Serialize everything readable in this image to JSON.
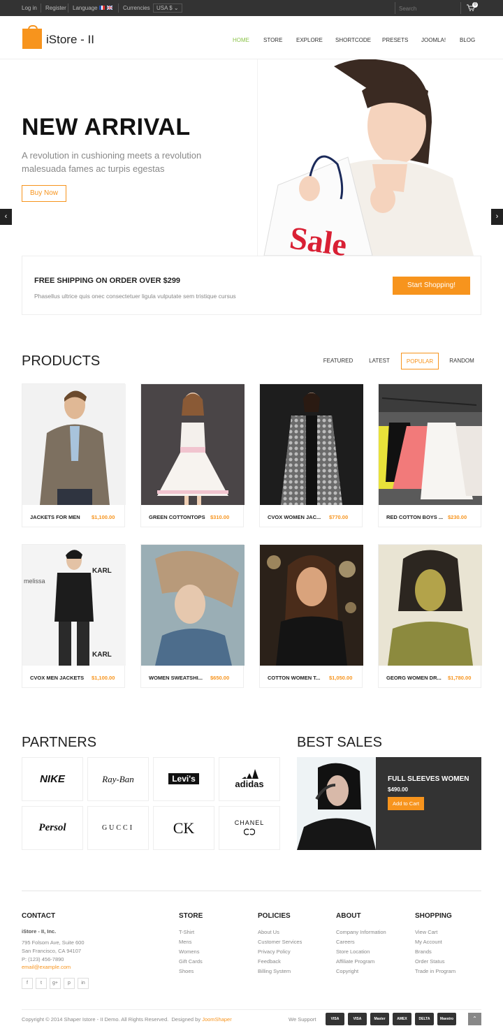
{
  "topbar": {
    "login": "Log in",
    "register": "Register",
    "language": "Language",
    "currencies": "Currencies",
    "currency_value": "USA $ ⌄",
    "search_placeholder": "Search",
    "cart_count": "0"
  },
  "header": {
    "logo": "iStore - II",
    "nav": [
      "HOME",
      "STORE",
      "EXPLORE",
      "SHORTCODE",
      "PRESETS",
      "JOOMLA!",
      "BLOG"
    ]
  },
  "hero": {
    "title": "NEW ARRIVAL",
    "line1": "A revolution in cushioning meets a revolution",
    "line2": "malesuada fames ac turpis egestas",
    "button": "Buy Now",
    "bag_text": "Sale",
    "prev": "‹",
    "next": "›"
  },
  "shipping": {
    "title": "FREE SHIPPING ON ORDER OVER $299",
    "subtitle": "Phasellus ultrice quis onec consectetuer ligula vulputate sem tristique cursus",
    "button": "Start Shopping!"
  },
  "products": {
    "title": "PRODUCTS",
    "tabs": [
      "FEATURED",
      "LATEST",
      "POPULAR",
      "RANDOM"
    ],
    "active_tab": "POPULAR",
    "items": [
      {
        "name": "JACKETS FOR MEN",
        "price": "$1,100.00"
      },
      {
        "name": "GREEN COTTONTOPS",
        "price": "$310.00"
      },
      {
        "name": "CVOX WOMEN JAC...",
        "price": "$770.00"
      },
      {
        "name": "RED COTTON BOYS ...",
        "price": "$230.00"
      },
      {
        "name": "CVOX MEN JACKETS",
        "price": "$1,100.00"
      },
      {
        "name": "WOMEN SWEATSHI...",
        "price": "$650.00"
      },
      {
        "name": "COTTON WOMEN T...",
        "price": "$1,050.00"
      },
      {
        "name": "GEORG WOMEN DR...",
        "price": "$1,780.00"
      }
    ]
  },
  "partners": {
    "title": "PARTNERS",
    "brands": [
      "NIKE",
      "Ray-Ban",
      "Levi's",
      "adidas",
      "Persol",
      "GUCCI",
      "CK",
      "CHANEL"
    ]
  },
  "best_sales": {
    "title": "BEST SALES",
    "name": "FULL SLEEVES WOMEN",
    "price": "$490.00",
    "button": "Add to Cart"
  },
  "footer": {
    "contact": {
      "title": "CONTACT",
      "company": "iStore - II, Inc.",
      "address1": "795 Folsom Ave, Suite 600",
      "address2": "San Francisco, CA 94107",
      "phone": "P: (123) 456-7890",
      "email": "email@example.com"
    },
    "columns": [
      {
        "title": "STORE",
        "links": [
          "T-Shirt",
          "Mens",
          "Womens",
          "Gift Cards",
          "Shoes"
        ]
      },
      {
        "title": "POLICIES",
        "links": [
          "About Us",
          "Customer Services",
          "Privacy Policy",
          "Feedback",
          "Billing System"
        ]
      },
      {
        "title": "ABOUT",
        "links": [
          "Company Information",
          "Careers",
          "Store Location",
          "Affiliate Program",
          "Copyright"
        ]
      },
      {
        "title": "SHOPPING",
        "links": [
          "View Cart",
          "My Account",
          "Brands",
          "Order Status",
          "Trade in Program"
        ]
      }
    ],
    "social": [
      "f",
      "t",
      "g+",
      "p",
      "in"
    ],
    "copyright": "Copyright © 2014 Shaper Istore - II Demo. All Rights Reserved.",
    "designed_by": "Designed by",
    "designer": "JoomShaper",
    "we_support": "We Support",
    "payments": [
      "VISA",
      "VISA",
      "Master",
      "AMEX",
      "DELTA",
      "Maestro"
    ],
    "to_top": "⌃"
  },
  "colors": {
    "accent": "#f7941d",
    "dark": "#333333"
  }
}
